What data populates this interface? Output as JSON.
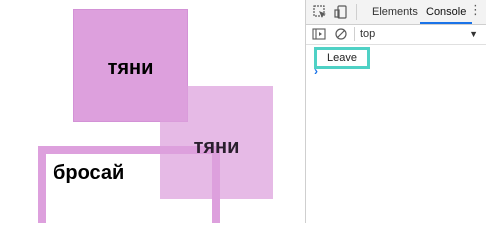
{
  "page": {
    "drag_item_1": "тяни",
    "drag_item_2": "тяни",
    "drop_zone_label": "бросай",
    "colors": {
      "box_fill": "#dda0dd",
      "outline": "#dda0dd"
    }
  },
  "devtools": {
    "tabs": [
      {
        "label": "Elements",
        "active": false
      },
      {
        "label": "Console",
        "active": true
      }
    ],
    "icons": [
      "inspect-icon",
      "device-toggle-icon",
      "more-icon"
    ],
    "console_toolbar": {
      "context": "top",
      "icons": [
        "sidebar-toggle-icon",
        "clear-console-icon"
      ]
    },
    "log": [
      {
        "text": "Leave"
      }
    ],
    "prompt": "›",
    "colors": {
      "active_tab": "#1a73e8",
      "highlight": "#4fd1c5"
    }
  }
}
